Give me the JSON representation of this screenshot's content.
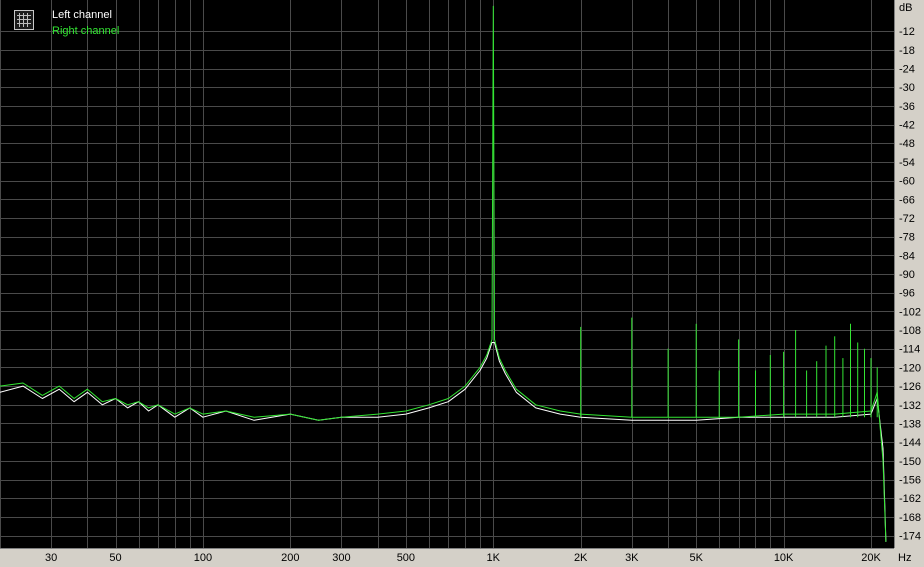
{
  "chart_data": {
    "type": "line",
    "title": "",
    "xlabel": "Hz",
    "ylabel": "dB",
    "x_scale": "log",
    "xlim": [
      20,
      24000
    ],
    "ylim": [
      -178,
      -2
    ],
    "grid": true,
    "legend_position": "top-left",
    "background_color": "#000000",
    "x_tick_labels": [
      {
        "value": 30,
        "label": "30"
      },
      {
        "value": 50,
        "label": "50"
      },
      {
        "value": 100,
        "label": "100"
      },
      {
        "value": 200,
        "label": "200"
      },
      {
        "value": 300,
        "label": "300"
      },
      {
        "value": 500,
        "label": "500"
      },
      {
        "value": 1000,
        "label": "1K"
      },
      {
        "value": 2000,
        "label": "2K"
      },
      {
        "value": 3000,
        "label": "3K"
      },
      {
        "value": 5000,
        "label": "5K"
      },
      {
        "value": 10000,
        "label": "10K"
      },
      {
        "value": 20000,
        "label": "20K"
      }
    ],
    "y_ticks": [
      -12,
      -18,
      -24,
      -30,
      -36,
      -42,
      -48,
      -54,
      -60,
      -66,
      -72,
      -78,
      -84,
      -90,
      -96,
      -102,
      -108,
      -114,
      -120,
      -126,
      -132,
      -138,
      -144,
      -150,
      -156,
      -162,
      -168,
      -174
    ],
    "series": [
      {
        "name": "Left channel",
        "color": "#ffffff",
        "points": [
          [
            20,
            -128
          ],
          [
            24,
            -126
          ],
          [
            28,
            -130
          ],
          [
            32,
            -127
          ],
          [
            36,
            -131
          ],
          [
            40,
            -128
          ],
          [
            45,
            -132
          ],
          [
            50,
            -130
          ],
          [
            55,
            -133
          ],
          [
            60,
            -131
          ],
          [
            65,
            -134
          ],
          [
            70,
            -132
          ],
          [
            80,
            -136
          ],
          [
            90,
            -133
          ],
          [
            100,
            -136
          ],
          [
            120,
            -134
          ],
          [
            150,
            -137
          ],
          [
            200,
            -135
          ],
          [
            250,
            -137
          ],
          [
            300,
            -136
          ],
          [
            400,
            -136
          ],
          [
            500,
            -135
          ],
          [
            600,
            -133
          ],
          [
            700,
            -131
          ],
          [
            800,
            -127
          ],
          [
            900,
            -121
          ],
          [
            950,
            -117
          ],
          [
            990,
            -112
          ],
          [
            1000,
            -112
          ],
          [
            1010,
            -112
          ],
          [
            1050,
            -118
          ],
          [
            1100,
            -122
          ],
          [
            1200,
            -128
          ],
          [
            1400,
            -133
          ],
          [
            1700,
            -135
          ],
          [
            2000,
            -136
          ],
          [
            3000,
            -137
          ],
          [
            5000,
            -137
          ],
          [
            7000,
            -136
          ],
          [
            10000,
            -136
          ],
          [
            15000,
            -136
          ],
          [
            20000,
            -135
          ],
          [
            21000,
            -130
          ],
          [
            22000,
            -146
          ],
          [
            22500,
            -176
          ]
        ],
        "spikes": []
      },
      {
        "name": "Right channel",
        "color": "#33e633",
        "points": [
          [
            20,
            -126
          ],
          [
            24,
            -125
          ],
          [
            28,
            -129
          ],
          [
            32,
            -126
          ],
          [
            36,
            -130
          ],
          [
            40,
            -127
          ],
          [
            45,
            -131
          ],
          [
            50,
            -130
          ],
          [
            55,
            -132
          ],
          [
            60,
            -131
          ],
          [
            65,
            -133
          ],
          [
            70,
            -132
          ],
          [
            80,
            -135
          ],
          [
            90,
            -133
          ],
          [
            100,
            -135
          ],
          [
            120,
            -134
          ],
          [
            150,
            -136
          ],
          [
            200,
            -135
          ],
          [
            250,
            -137
          ],
          [
            300,
            -136
          ],
          [
            400,
            -135
          ],
          [
            500,
            -134
          ],
          [
            600,
            -132
          ],
          [
            700,
            -130
          ],
          [
            800,
            -126
          ],
          [
            900,
            -120
          ],
          [
            950,
            -116
          ],
          [
            990,
            -111
          ],
          [
            1000,
            -4
          ],
          [
            1010,
            -111
          ],
          [
            1050,
            -117
          ],
          [
            1100,
            -121
          ],
          [
            1200,
            -127
          ],
          [
            1400,
            -132
          ],
          [
            1700,
            -134
          ],
          [
            2000,
            -135
          ],
          [
            3000,
            -136
          ],
          [
            5000,
            -136
          ],
          [
            7000,
            -136
          ],
          [
            10000,
            -135
          ],
          [
            15000,
            -135
          ],
          [
            20000,
            -134
          ],
          [
            21000,
            -128
          ],
          [
            22000,
            -150
          ],
          [
            22500,
            -176
          ]
        ],
        "spikes": [
          [
            2000,
            -107
          ],
          [
            3000,
            -104
          ],
          [
            4000,
            -114
          ],
          [
            5000,
            -106
          ],
          [
            6000,
            -121
          ],
          [
            7000,
            -111
          ],
          [
            8000,
            -121
          ],
          [
            9000,
            -116
          ],
          [
            10000,
            -115
          ],
          [
            11000,
            -108
          ],
          [
            12000,
            -121
          ],
          [
            13000,
            -118
          ],
          [
            14000,
            -113
          ],
          [
            15000,
            -110
          ],
          [
            16000,
            -117
          ],
          [
            17000,
            -106
          ],
          [
            18000,
            -112
          ],
          [
            19000,
            -114
          ],
          [
            20000,
            -117
          ],
          [
            21000,
            -120
          ]
        ]
      }
    ]
  }
}
